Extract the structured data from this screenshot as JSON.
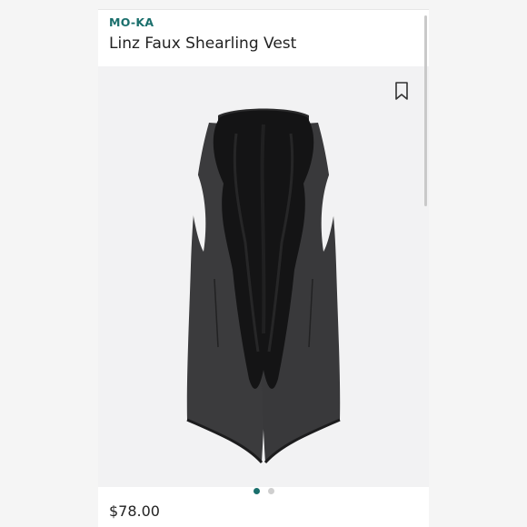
{
  "product": {
    "brand": "MO-KA",
    "name": "Linz Faux Shearling Vest",
    "price": "$78.00"
  },
  "icons": {
    "save": "bookmark-icon"
  },
  "carousel": {
    "count": 2,
    "active_index": 0
  },
  "colors": {
    "brand_accent": "#1a6f6c",
    "dot_inactive": "#cfcfcf",
    "image_background": "#f2f2f3"
  }
}
